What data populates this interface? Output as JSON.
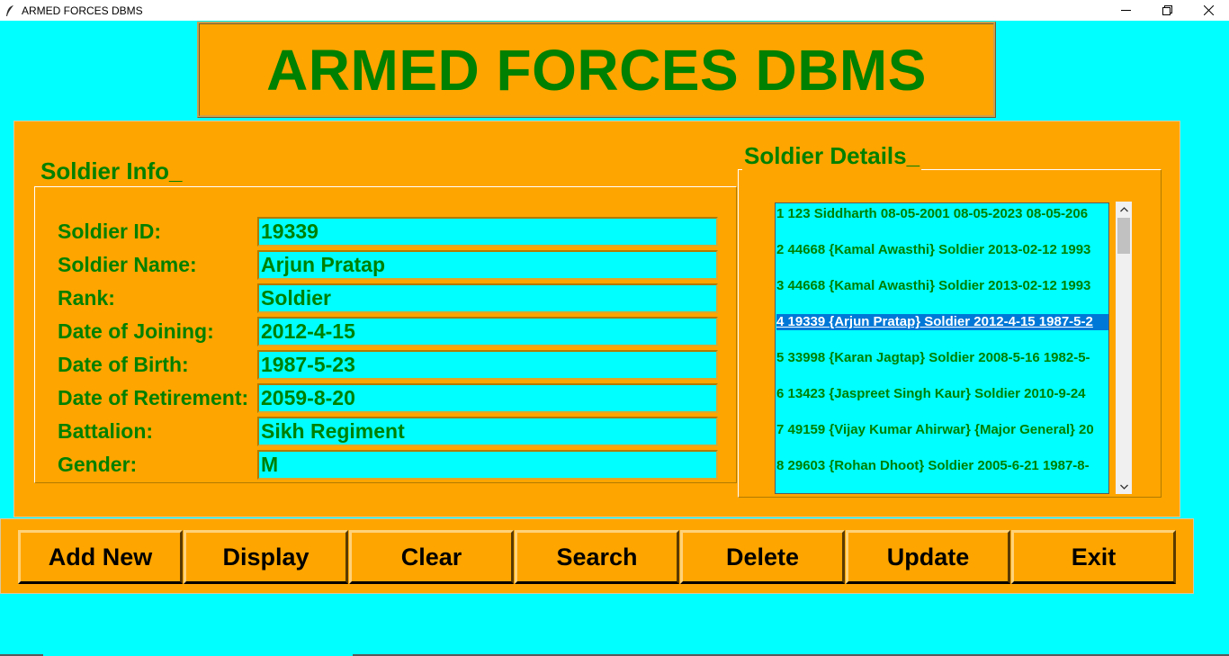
{
  "window": {
    "title": "ARMED FORCES DBMS"
  },
  "banner": {
    "title": "ARMED FORCES DBMS"
  },
  "soldier_info": {
    "heading": "Soldier Info_",
    "fields": [
      {
        "label": "Soldier ID:",
        "value": "19339"
      },
      {
        "label": "Soldier Name:",
        "value": "Arjun Pratap"
      },
      {
        "label": "Rank:",
        "value": "Soldier"
      },
      {
        "label": "Date of Joining:",
        "value": "2012-4-15"
      },
      {
        "label": "Date of Birth:",
        "value": "1987-5-23"
      },
      {
        "label": "Date of Retirement:",
        "value": "2059-8-20"
      },
      {
        "label": "Battalion:",
        "value": "Sikh Regiment"
      },
      {
        "label": "Gender:",
        "value": "M"
      }
    ]
  },
  "soldier_details": {
    "heading": "Soldier Details_",
    "rows": [
      "1 123 Siddharth 08-05-2001 08-05-2023 08-05-206",
      "2 44668 {Kamal Awasthi} Soldier 2013-02-12 1993",
      "3 44668 {Kamal Awasthi} Soldier 2013-02-12 1993",
      "4 19339 {Arjun Pratap} Soldier 2012-4-15 1987-5-2",
      "5 33998 {Karan Jagtap} Soldier 2008-5-16 1982-5-",
      "6 13423 {Jaspreet Singh Kaur} Soldier 2010-9-24",
      "7 49159 {Vijay Kumar Ahirwar} {Major General} 20",
      "8 29603 {Rohan Dhoot} Soldier 2005-6-21 1987-8-"
    ],
    "selected_index": 3
  },
  "buttons": {
    "add_new": "Add New",
    "display": "Display",
    "clear": "Clear",
    "search": "Search",
    "delete": "Delete",
    "update": "Update",
    "exit": "Exit"
  },
  "colors": {
    "background": "#00ffff",
    "panel": "#ffa500",
    "text_green": "#008000",
    "selection": "#0078d7"
  }
}
